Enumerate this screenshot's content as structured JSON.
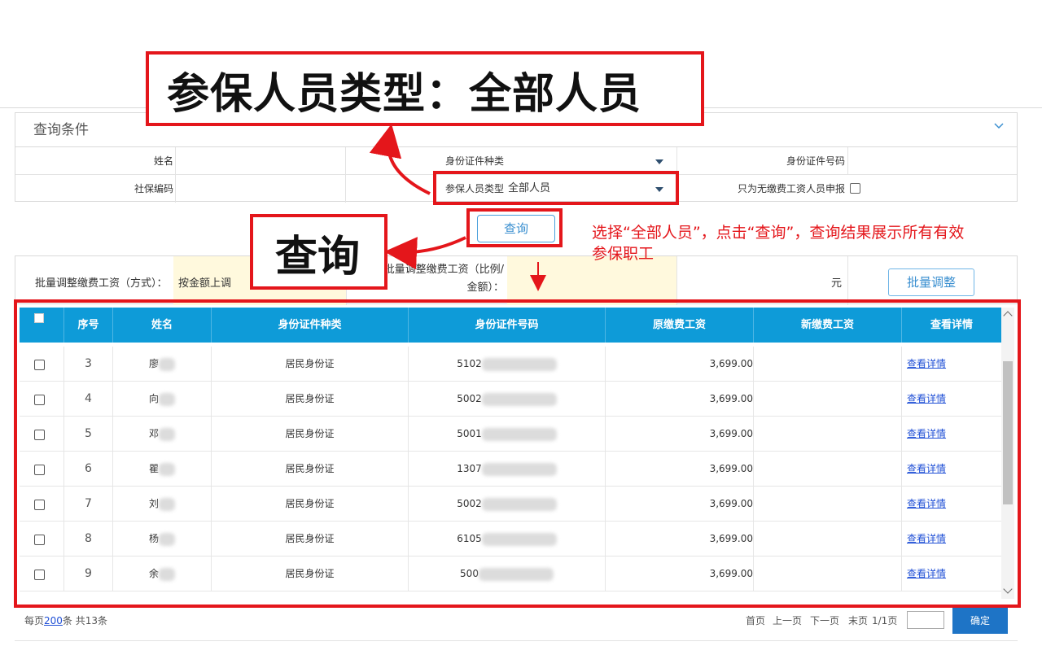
{
  "query_section": {
    "title": "查询条件",
    "labels": {
      "name": "姓名",
      "id_type": "身份证件种类",
      "id_number": "身份证件号码",
      "social_code": "社保编码",
      "insured_type": "参保人员类型",
      "no_wage_only": "只为无缴费工资人员申报"
    },
    "insured_type_value": "全部人员",
    "query_button": "查询"
  },
  "batch": {
    "method_label": "批量调整缴费工资（方式）：",
    "method_value": "按金额上调",
    "amount_label": "批量调整缴费工资（比例/金额）：",
    "unit": "元",
    "button": "批量调整"
  },
  "table": {
    "headers": [
      "序号",
      "姓名",
      "身份证件种类",
      "身份证件号码",
      "原缴费工资",
      "新缴费工资",
      "查看详情"
    ],
    "rows": [
      {
        "no": "3",
        "name": "廖",
        "id_type": "居民身份证",
        "id_prefix": "5102",
        "orig_wage": "3,699.00",
        "new_wage": "",
        "detail": "查看详情"
      },
      {
        "no": "4",
        "name": "向",
        "id_type": "居民身份证",
        "id_prefix": "5002",
        "orig_wage": "3,699.00",
        "new_wage": "",
        "detail": "查看详情"
      },
      {
        "no": "5",
        "name": "邓",
        "id_type": "居民身份证",
        "id_prefix": "5001",
        "orig_wage": "3,699.00",
        "new_wage": "",
        "detail": "查看详情"
      },
      {
        "no": "6",
        "name": "瞿",
        "id_type": "居民身份证",
        "id_prefix": "1307",
        "orig_wage": "3,699.00",
        "new_wage": "",
        "detail": "查看详情"
      },
      {
        "no": "7",
        "name": "刘",
        "id_type": "居民身份证",
        "id_prefix": "5002",
        "orig_wage": "3,699.00",
        "new_wage": "",
        "detail": "查看详情"
      },
      {
        "no": "8",
        "name": "杨",
        "id_type": "居民身份证",
        "id_prefix": "6105",
        "orig_wage": "3,699.00",
        "new_wage": "",
        "detail": "查看详情"
      },
      {
        "no": "9",
        "name": "余",
        "id_type": "居民身份证",
        "id_prefix": "500",
        "orig_wage": "3,699.00",
        "new_wage": "",
        "detail": "查看详情"
      }
    ]
  },
  "pager": {
    "per_page_prefix": "每页",
    "per_page_value": "200",
    "per_page_suffix": "条 共13条",
    "first": "首页",
    "prev": "上一页",
    "next": "下一页",
    "last": "末页",
    "page_status": "1/1页",
    "confirm": "确定"
  },
  "annotations": {
    "insured_type_callout": "参保人员类型：全部人员",
    "query_callout": "查询",
    "note": "选择“全部人员”，点击“查询”，查询结果展示所有有效参保职工"
  },
  "colors": {
    "header_blue": "#0e9bd8",
    "annotation_red": "#e4161b",
    "confirm_blue": "#1e74c6"
  }
}
